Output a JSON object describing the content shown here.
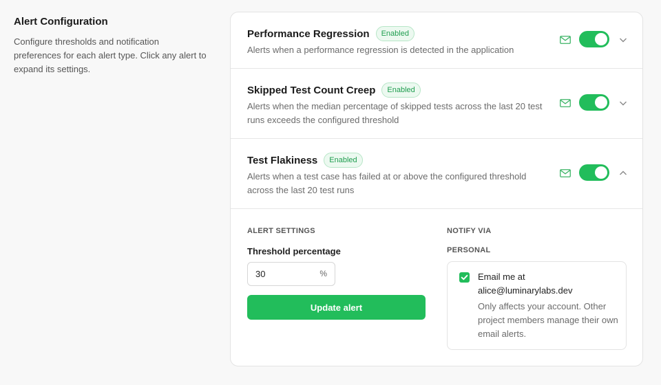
{
  "section": {
    "title": "Alert Configuration",
    "description": "Configure thresholds and notification preferences for each alert type. Click any alert to expand its settings."
  },
  "alerts": [
    {
      "name": "Performance Regression",
      "badge": "Enabled",
      "description": "Alerts when a performance regression is detected in the application",
      "enabled": true,
      "expanded": false
    },
    {
      "name": "Skipped Test Count Creep",
      "badge": "Enabled",
      "description": "Alerts when the median percentage of skipped tests across the last 20 test runs exceeds the configured threshold",
      "enabled": true,
      "expanded": false
    },
    {
      "name": "Test Flakiness",
      "badge": "Enabled",
      "description": "Alerts when a test case has failed at or above the configured threshold across the last 20 test runs",
      "enabled": true,
      "expanded": true
    }
  ],
  "settings": {
    "heading": "ALERT SETTINGS",
    "threshold_label": "Threshold percentage",
    "threshold_value": "30",
    "threshold_unit": "%",
    "update_button": "Update alert"
  },
  "notify": {
    "heading": "NOTIFY VIA",
    "personal_heading": "PERSONAL",
    "email_prefix": "Email me at",
    "email": "alice@luminarylabs.dev",
    "email_checked": true,
    "note": "Only affects your account. Other project members manage their own email alerts."
  },
  "colors": {
    "accent": "#22bd5b",
    "badge_text": "#1f9d4f",
    "badge_bg": "#ecf9f0",
    "mail_icon": "#3cb466"
  },
  "icons": [
    "mail-icon",
    "chevron-down-icon",
    "chevron-up-icon",
    "check-icon"
  ]
}
